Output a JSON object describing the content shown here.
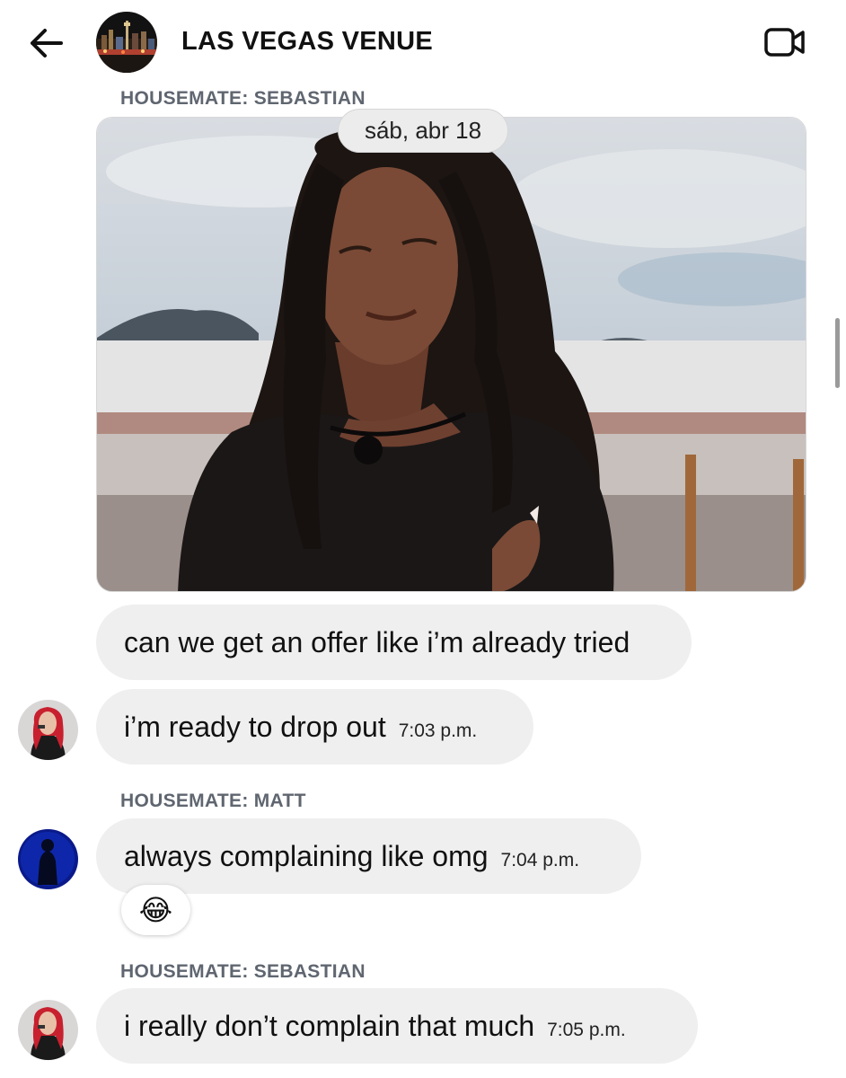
{
  "header": {
    "title": "LAS VEGAS VENUE",
    "back_icon": "arrow-left-icon",
    "video_icon": "video-camera-icon"
  },
  "date_pill": "sáb, abr 18",
  "messages": [
    {
      "sender_label": "HOUSEMATE: SEBASTIAN",
      "type": "image",
      "image": "woman-with-crossed-arms-gif"
    },
    {
      "text": "can we get an offer like i’m already tried"
    },
    {
      "text": "i’m ready to drop out",
      "time": "7:03 p.m."
    },
    {
      "sender_label": "HOUSEMATE: MATT",
      "text": "always complaining like omg",
      "time": "7:04 p.m.",
      "reaction": "😂"
    },
    {
      "sender_label": "HOUSEMATE: SEBASTIAN",
      "text": "i really don’t complain that much",
      "time": "7:05 p.m."
    }
  ],
  "colors": {
    "bubble": "#efefef",
    "label": "#5f6670",
    "background": "#ffffff"
  }
}
